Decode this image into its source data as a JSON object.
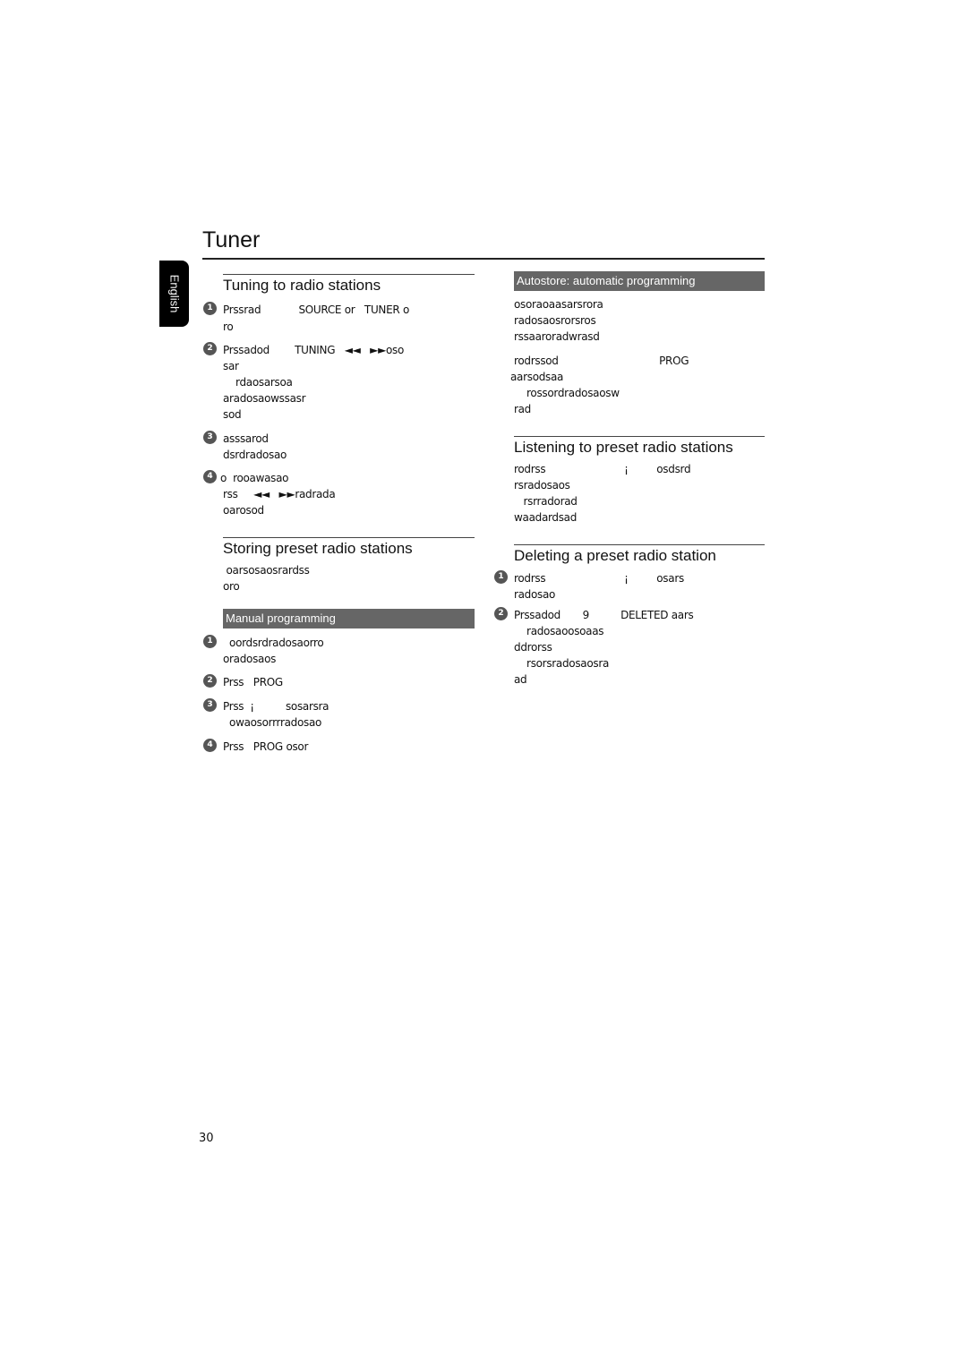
{
  "page": {
    "title": "Tuner",
    "language_tab": "English",
    "page_number": "30"
  },
  "left": {
    "tuning": {
      "heading": "Tuning to radio stations",
      "steps": [
        {
          "num": "1",
          "lines": [
            "Prssrad            SOURCE or   TUNER o",
            "ro"
          ]
        },
        {
          "num": "2",
          "lines": [
            "Prssadod        TUNING   ◄◄   ►►oso",
            "sar",
            "    rdaosarsoa",
            "aradosaowssasr",
            "sod"
          ]
        },
        {
          "num": "3",
          "lines": [
            "asssarod",
            "dsrdradosao"
          ]
        },
        {
          "num": "4",
          "lines": [
            "o  rooawasao",
            "rss     ◄◄   ►►radrada",
            "oarosod"
          ]
        }
      ]
    },
    "storing": {
      "heading": "Storing preset radio stations",
      "intro": [
        " oarsosaosrardss",
        "oro"
      ],
      "manual_bar": "Manual programming",
      "steps": [
        {
          "num": "1",
          "lines": [
            "  oordsrdradosaorro",
            "oradosaos"
          ]
        },
        {
          "num": "2",
          "lines": [
            "Prss   PROG"
          ]
        },
        {
          "num": "3",
          "lines": [
            "Prss  ¡          sosarsra",
            "  owaosorrrradosao"
          ]
        },
        {
          "num": "4",
          "lines": [
            "Prss   PROG osor"
          ]
        }
      ]
    }
  },
  "right": {
    "autostore": {
      "bar": "Autostore: automatic programming",
      "para1": [
        "osoraoaasarsrora",
        "radosaosrorsros",
        "rssaaroradwrasd"
      ],
      "para2": [
        "rodrssod                                PROG",
        "aarsodsaa",
        "    rossordradosaosw",
        "rad"
      ]
    },
    "listening": {
      "heading": "Listening to preset radio stations",
      "lines": [
        "rodrss                         ¡         osdsrd",
        "rsradosaos",
        "   rsrradorad",
        "waadardsad"
      ]
    },
    "deleting": {
      "heading": "Deleting a preset radio station",
      "steps": [
        {
          "num": "1",
          "lines": [
            "rodrss                         ¡         osars",
            "radosao"
          ]
        },
        {
          "num": "2",
          "lines": [
            "Prssadod       9          DELETED aars",
            "    radosaoosoaas",
            "ddrorss",
            "    rsorsradosaosra",
            "ad"
          ]
        }
      ]
    }
  }
}
